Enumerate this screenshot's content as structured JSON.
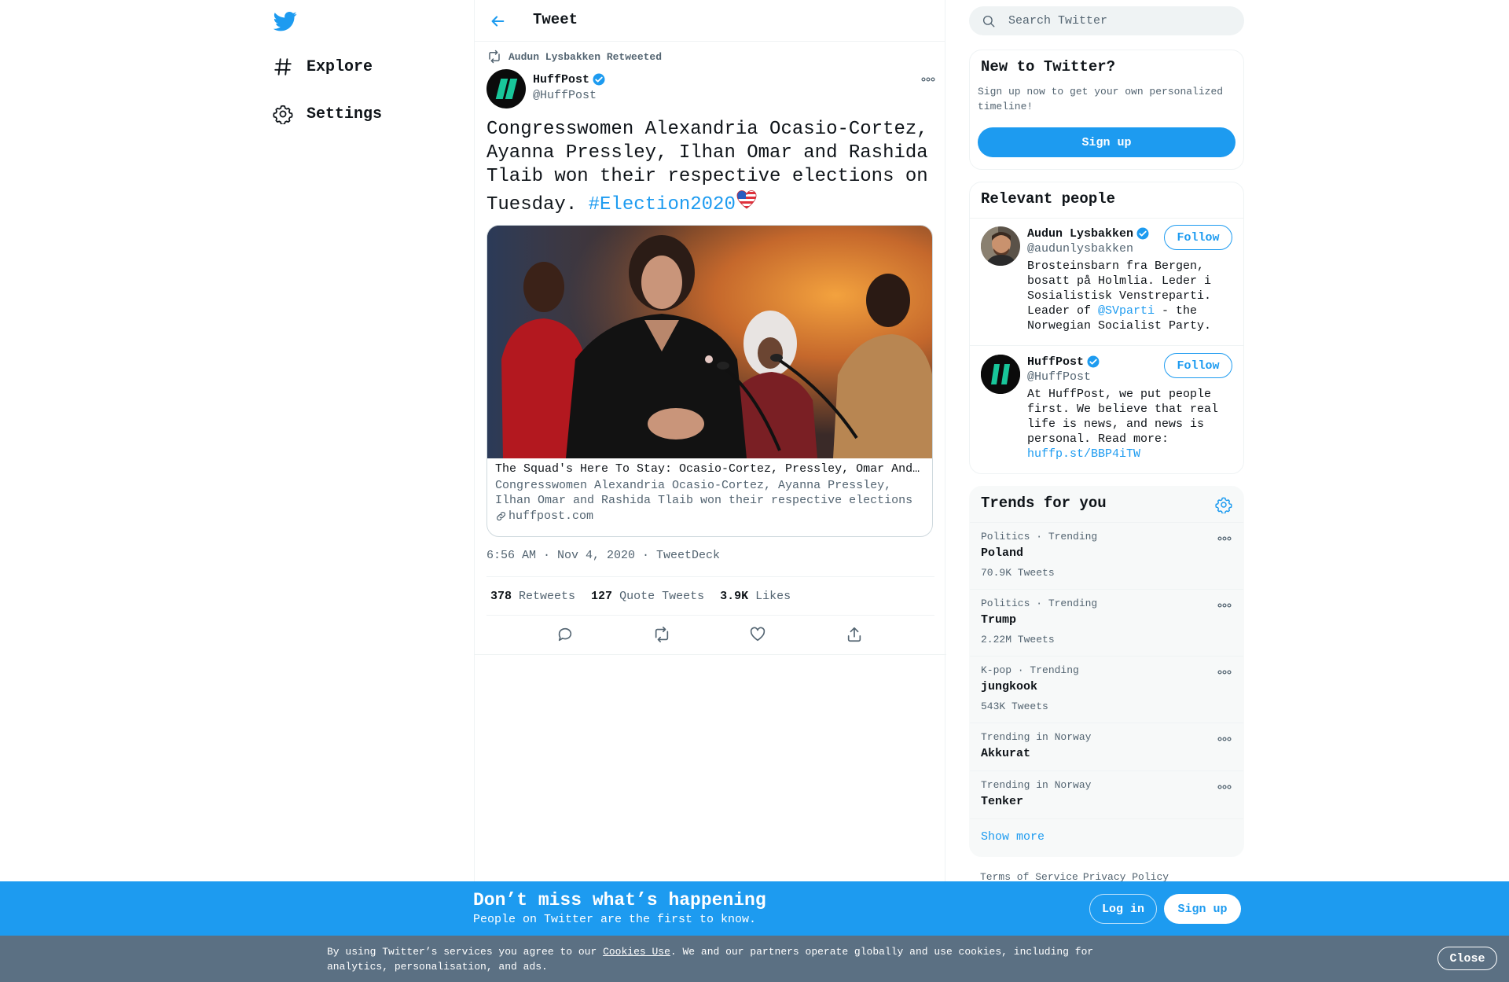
{
  "nav": {
    "items": [
      {
        "label": "Explore",
        "icon": "hashtag-icon"
      },
      {
        "label": "Settings",
        "icon": "gear-icon"
      }
    ]
  },
  "header": {
    "title": "Tweet"
  },
  "tweet": {
    "retweeted_by": "Audun Lysbakken Retweeted",
    "author_name": "HuffPost",
    "author_handle": "@HuffPost",
    "text": "Congresswomen Alexandria Ocasio-Cortez, Ayanna Pressley, Ilhan Omar and Rashida Tlaib won their respective elections on Tuesday. ",
    "hashtag": "#Election2020",
    "card": {
      "title": "The Squad's Here To Stay: Ocasio-Cortez, Pressley, Omar And Tlaib All Win Re-Election",
      "description": "Congresswomen Alexandria Ocasio-Cortez, Ayanna Pressley, Ilhan Omar and Rashida Tlaib won their respective elections on Tuesday.",
      "domain": "huffpost.com"
    },
    "time": "6:56 AM · Nov 4, 2020",
    "separator": " · ",
    "source": "TweetDeck",
    "stats": [
      {
        "value": "378",
        "label": "Retweets"
      },
      {
        "value": "127",
        "label": "Quote Tweets"
      },
      {
        "value": "3.9K",
        "label": "Likes"
      }
    ]
  },
  "search": {
    "placeholder": "Search Twitter"
  },
  "new_to_twitter": {
    "title": "New to Twitter?",
    "subtitle": "Sign up now to get your own personalized timeline!",
    "button": "Sign up"
  },
  "relevant_people": {
    "title": "Relevant people",
    "people": [
      {
        "name": "Audun Lysbakken",
        "handle": "@audunlysbakken",
        "bio_before": "Brosteinsbarn fra Bergen, bosatt på Holmlia. Leder i Sosialistisk Venstreparti. Leader of ",
        "bio_link": "@SVparti",
        "bio_after": " - the Norwegian Socialist Party.",
        "button": "Follow"
      },
      {
        "name": "HuffPost",
        "handle": "@HuffPost",
        "bio_before": "At HuffPost, we put people first. We believe that real life is news, and news is personal. Read more: ",
        "bio_link": "huffp.st/BBP4iTW",
        "bio_after": "",
        "button": "Follow"
      }
    ]
  },
  "trends": {
    "title": "Trends for you",
    "items": [
      {
        "context": "Politics · Trending",
        "name": "Poland",
        "count": "70.9K Tweets"
      },
      {
        "context": "Politics · Trending",
        "name": "Trump",
        "count": "2.22M Tweets"
      },
      {
        "context": "K-pop · Trending",
        "name": "jungkook",
        "count": "543K Tweets"
      },
      {
        "context": "Trending in Norway",
        "name": "Akkurat",
        "count": ""
      },
      {
        "context": "Trending in Norway",
        "name": "Tenker",
        "count": ""
      }
    ],
    "show_more": "Show more"
  },
  "footer": {
    "terms": "Terms of Service",
    "privacy": "Privacy Policy"
  },
  "bottom_bar": {
    "title": "Don’t miss what’s happening",
    "subtitle": "People on Twitter are the first to know.",
    "login": "Log in",
    "signup": "Sign up"
  },
  "cookie": {
    "text_before": "By using Twitter’s services you agree to our ",
    "link": "Cookies Use",
    "text_after": ". We and our partners operate globally and use cookies, including for analytics, personalisation, and ads.",
    "close": "Close"
  },
  "colors": {
    "accent": "#1d9bf0",
    "cookie_bar": "#5b7083",
    "text_secondary": "#536471"
  }
}
